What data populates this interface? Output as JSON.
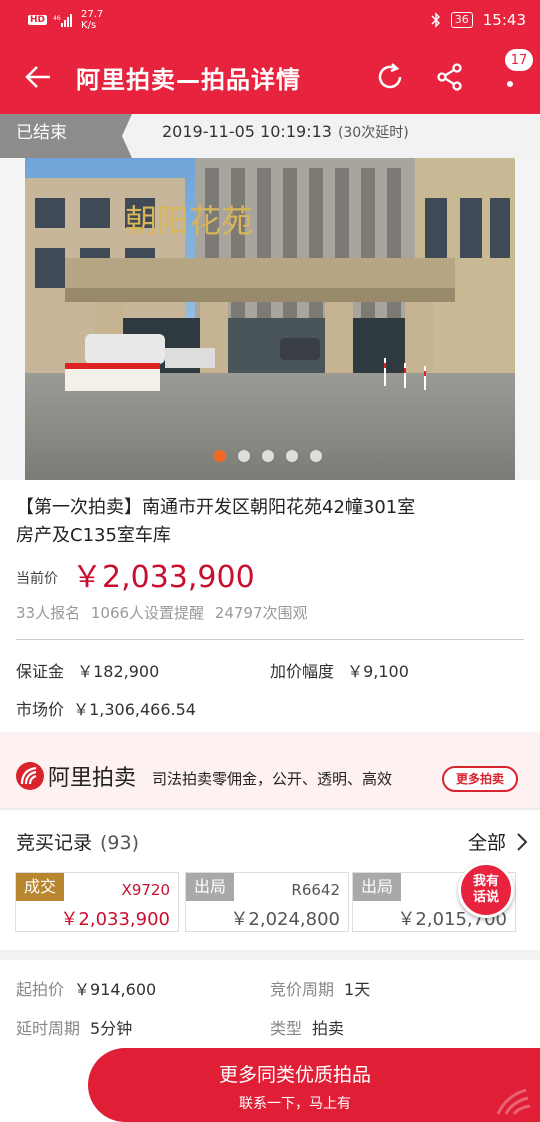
{
  "status_bar": {
    "speed_value": "27.7",
    "speed_unit": "K/s",
    "battery": "36",
    "time": "15:43"
  },
  "nav": {
    "title": "阿里拍卖—拍品详情",
    "notification_count": "17"
  },
  "auction_time": {
    "status": "已结束",
    "end_time": "2019-11-05 10:19:13",
    "delay_note": "(30次延时)"
  },
  "carousel": {
    "sign_text": "朝阳花苑",
    "page_count": 5,
    "active_index": 0
  },
  "lot": {
    "title": "【第一次拍卖】南通市开发区朝阳花苑42幢301室房产及C135室车库",
    "price_label": "当前价",
    "current_price": "￥2,033,900",
    "stats": "33人报名  1066人设置提醒  24797次围观",
    "deposit_label": "保证金",
    "deposit_value": "￥182,900",
    "increment_label": "加价幅度",
    "increment_value": "￥9,100",
    "market_label": "市场价",
    "market_value": "￥1,306,466.54"
  },
  "brand": {
    "logo_text": "阿里拍卖",
    "slogan": "司法拍卖零佣金，公开、透明、高效",
    "more_button": "更多拍卖"
  },
  "bids": {
    "header": "竞买记录",
    "count": "(93)",
    "all_label": "全部",
    "records": [
      {
        "status": "成交",
        "bidder": "X9720",
        "amount": "￥2,033,900"
      },
      {
        "status": "出局",
        "bidder": "R6642",
        "amount": "￥2,024,800"
      },
      {
        "status": "出局",
        "bidder": "",
        "amount": "￥2,015,700"
      }
    ]
  },
  "chat_bubble": {
    "line1": "我有",
    "line2": "话说"
  },
  "details": {
    "start_price_label": "起拍价",
    "start_price_value": "￥914,600",
    "cycle_label": "竞价周期",
    "cycle_value": "1天",
    "delay_label": "延时周期",
    "delay_value": "5分钟",
    "type_label": "类型",
    "type_value": "拍卖"
  },
  "cta": {
    "main": "更多同类优质拍品",
    "sub": "联系一下，马上有"
  },
  "colors": {
    "brand_red": "#e8233e",
    "price_red": "#c8102e",
    "win_gold": "#b8862e",
    "active_dot": "#f26a22"
  }
}
